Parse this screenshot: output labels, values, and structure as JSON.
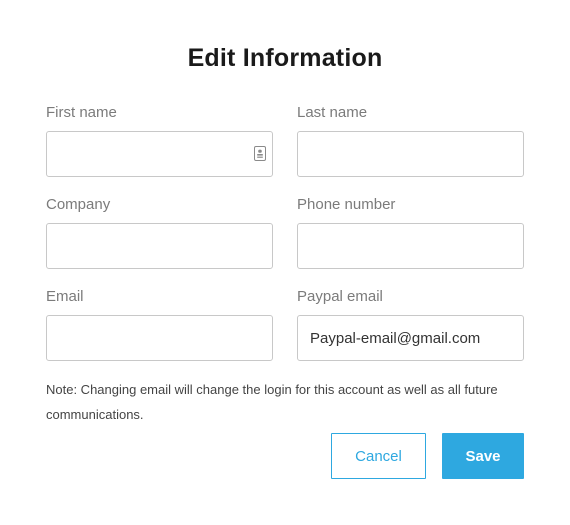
{
  "dialog": {
    "title": "Edit Information",
    "fields": {
      "first_name": {
        "label": "First name",
        "value": "",
        "placeholder": ""
      },
      "last_name": {
        "label": "Last name",
        "value": "",
        "placeholder": ""
      },
      "company": {
        "label": "Company",
        "value": "",
        "placeholder": ""
      },
      "phone": {
        "label": "Phone number",
        "value": "",
        "placeholder": ""
      },
      "email": {
        "label": "Email",
        "value": "",
        "placeholder": ""
      },
      "paypal_email": {
        "label": "Paypal email",
        "value": "Paypal-email@gmail.com",
        "placeholder": ""
      }
    },
    "note": "Note: Changing email will change the login for this account as well as all future communications.",
    "buttons": {
      "cancel": "Cancel",
      "save": "Save"
    },
    "icons": {
      "first_name_field_icon": "contact-card-icon"
    },
    "colors": {
      "accent": "#2ea8e0",
      "title": "#1a1a1a",
      "label": "#7b7b7b",
      "border": "#c8c8c8"
    }
  }
}
